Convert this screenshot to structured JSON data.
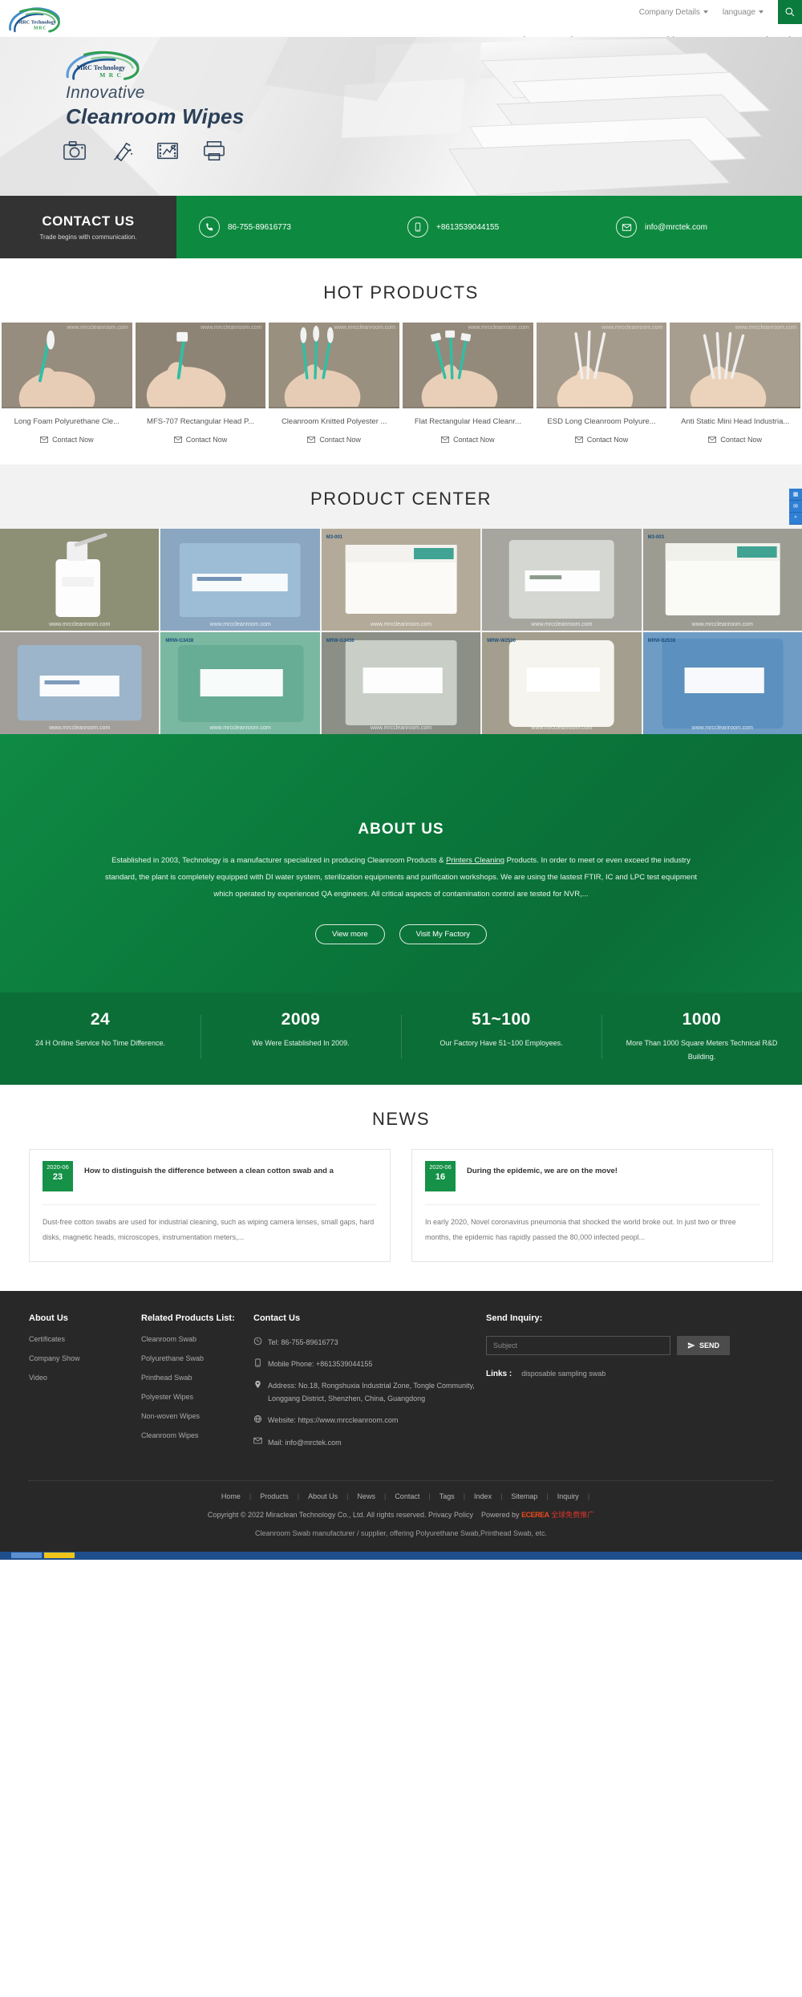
{
  "header": {
    "company_details": "Company Details",
    "language": "language",
    "search_icon": "search-icon",
    "logo_text": "MRC Technology",
    "logo_sub": "MRC",
    "nav": [
      {
        "label": "Home",
        "has_caret": false
      },
      {
        "label": "Products",
        "has_caret": true
      },
      {
        "label": "About Us",
        "has_caret": true
      },
      {
        "label": "News",
        "has_caret": false
      },
      {
        "label": "Video",
        "has_caret": false
      },
      {
        "label": "Contact",
        "has_caret": false
      },
      {
        "label": "Send Inquiry",
        "has_caret": false
      }
    ]
  },
  "hero": {
    "logo_main": "MRC Technology",
    "logo_sub": "M R C",
    "line1": "Innovative",
    "line2": "Cleanroom Wipes",
    "icons": [
      "camera-icon",
      "spray-bottle-icon",
      "film-strip-icon",
      "printer-icon"
    ]
  },
  "contact_strip": {
    "title": "CONTACT US",
    "subtitle": "Trade begins with communication.",
    "items": [
      {
        "icon": "phone-icon",
        "value": "86-755-89616773"
      },
      {
        "icon": "mobile-icon",
        "value": "+8613539044155"
      },
      {
        "icon": "mail-icon",
        "value": "info@mrctek.com"
      }
    ]
  },
  "hot_products": {
    "title": "HOT PRODUCTS",
    "watermark": "www.mrccleanroom.com",
    "contact_label": "Contact Now",
    "items": [
      {
        "name": "Long Foam Polyurethane Cle..."
      },
      {
        "name": "MFS-707 Rectangular Head P..."
      },
      {
        "name": "Cleanroom Knitted Polyester ..."
      },
      {
        "name": "Flat Rectangular Head Cleanr..."
      },
      {
        "name": "ESD Long Cleanroom Polyure..."
      },
      {
        "name": "Anti Static Mini Head Industria..."
      }
    ]
  },
  "product_center": {
    "title": "PRODUCT CENTER",
    "watermark": "www.mrccleanroom.com",
    "cells": [
      {
        "label": "",
        "bg": "#8f8f73"
      },
      {
        "label": "",
        "bg": "#8fa8bd"
      },
      {
        "label": "M3-001",
        "bg": "#b4ab9a"
      },
      {
        "label": "",
        "bg": "#a7a7a1"
      },
      {
        "label": "M3-003",
        "bg": "#9d9d94"
      },
      {
        "label": "",
        "bg": "#a7a4a0"
      },
      {
        "label": "MRW-G3438",
        "bg": "#7fb9a4"
      },
      {
        "label": "MRW-G3436",
        "bg": "#8a8e85"
      },
      {
        "label": "MRW-W2530",
        "bg": "#a39e8e"
      },
      {
        "label": "MRW-B2538",
        "bg": "#6f9dc6"
      }
    ],
    "side_tools": [
      "qr-icon",
      "wechat-icon",
      "scroll-top-icon"
    ]
  },
  "about": {
    "title": "ABOUT US",
    "text_part1": "Established in 2003, Technology is a manufacturer specialized in producing Cleanroom Products & ",
    "text_link": "Printers Cleaning",
    "text_part2": " Products. In order to meet or even exceed the industry standard, the plant is completely equipped with DI water system, sterilization equipments and purification workshops. We are using the lastest FTIR, IC and LPC test equipment which operated by experienced QA engineers. All critical aspects of contamination control are tested for NVR,...",
    "btn_more": "View more",
    "btn_factory": "Visit My Factory"
  },
  "stats": [
    {
      "num": "24",
      "desc": "24 H Online Service No Time Difference."
    },
    {
      "num": "2009",
      "desc": "We Were Established In 2009."
    },
    {
      "num": "51~100",
      "desc": "Our Factory Have 51~100 Employees."
    },
    {
      "num": "1000",
      "desc": "More Than 1000 Square Meters Technical R&D Building."
    }
  ],
  "news": {
    "title": "NEWS",
    "items": [
      {
        "ym": "2020-06",
        "day": "23",
        "headline": "How to distinguish the difference between a clean cotton swab and a",
        "excerpt": "Dust-free cotton swabs are used for industrial cleaning, such as wiping camera lenses, small gaps, hard disks, magnetic heads, microscopes, instrumentation meters,..."
      },
      {
        "ym": "2020-06",
        "day": "16",
        "headline": "During the epidemic, we are on the move!",
        "excerpt": "In early 2020, Novel coronavirus pneumonia that shocked the world broke out. In just two or three months, the epidemic has rapidly passed the 80,000 infected peopl..."
      }
    ]
  },
  "footer": {
    "about": {
      "title": "About Us",
      "links": [
        "Certificates",
        "Company Show",
        "Video"
      ]
    },
    "related": {
      "title": "Related Products List:",
      "links": [
        "Cleanroom Swab",
        "Polyurethane Swab",
        "Printhead Swab",
        "Polyester Wipes",
        "Non-woven Wipes",
        "Cleanroom Wipes"
      ]
    },
    "contact": {
      "title": "Contact Us",
      "tel": "Tel: 86-755-89616773",
      "mobile": "Mobile Phone: +8613539044155",
      "address": "Address: No.18, Rongshuxia Industrial Zone, Tongle Community, Longgang District, Shenzhen, China, Guangdong",
      "website": "Website: https://www.mrccleanroom.com",
      "mail": "Mail: info@mrctek.com"
    },
    "inquiry": {
      "title": "Send Inquiry:",
      "subject_placeholder": "Subject",
      "subject_value": "",
      "send_label": "SEND",
      "links_label": "Links :",
      "links_value": "disposable sampling swab"
    },
    "bottom_nav": [
      "Home",
      "Products",
      "About Us",
      "News",
      "Contact",
      "Tags",
      "Index",
      "Sitemap",
      "Inquiry"
    ],
    "copyright": "Copyright © 2022 Miraclean Technology Co., Ltd. All rights reserved.",
    "privacy": "Privacy Policy",
    "powered_by": "Powered by",
    "powered_logo": "ECEREA",
    "powered_cn": "全球免费推广",
    "tagline": "Cleanroom Swab manufacturer / supplier, offering Polyurethane Swab,Printhead Swab, etc."
  },
  "colors": {
    "brand_green": "#0d8a3f",
    "dark_green": "#0c6e37",
    "footer_dark": "#282828",
    "contact_dark": "#333333",
    "hero_navy": "#2b4058"
  }
}
